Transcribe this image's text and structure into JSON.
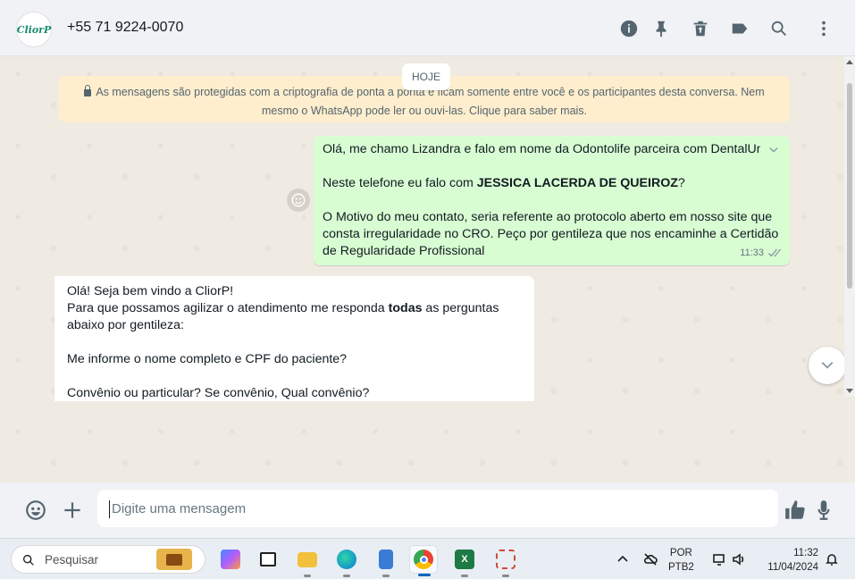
{
  "header": {
    "avatar_text": "CliorP",
    "contact_name": "+55 71 9224-0070",
    "icons": [
      "info-icon",
      "pin-icon",
      "delete-icon",
      "label-icon",
      "search-icon",
      "menu-icon"
    ]
  },
  "chat": {
    "date_chip": "HOJE",
    "encryption_notice": "As mensagens são protegidas com a criptografia de ponta a ponta e ficam somente entre você e os participantes desta conversa. Nem mesmo o WhatsApp pode ler ou ouvi-las. Clique para saber mais.",
    "outgoing": {
      "line1": "Olá, me chamo Lizandra e falo em nome da Odontolife parceira com DentalUni",
      "line2_prefix": "Neste telefone eu falo com ",
      "line2_bold": "JESSICA LACERDA DE QUEIROZ",
      "line2_suffix": "?",
      "line3": "O Motivo do meu contato, seria referente ao protocolo aberto em nosso site que consta irregularidade no CRO. Peço por gentileza que nos encaminhe a Certidão de Regularidade Profissional",
      "time": "11:33"
    },
    "incoming": {
      "line1": "Olá! Seja bem vindo a CliorP!",
      "line2_prefix": "Para que possamos agilizar o atendimento me responda ",
      "line2_bold": "todas",
      "line2_suffix": " as perguntas abaixo por gentileza:",
      "line3": "Me informe o nome completo e CPF do paciente?",
      "line4": "Convênio ou particular? Se convênio, Qual convênio?"
    }
  },
  "composer": {
    "placeholder": "Digite uma mensagem"
  },
  "taskbar": {
    "search_label": "Pesquisar",
    "lang_line1": "POR",
    "lang_line2": "PTB2",
    "time": "11:32",
    "date": "11/04/2024"
  },
  "colors": {
    "outgoing_bubble": "#d9fdd3",
    "encryption_bg": "#ffeecd",
    "chat_bg": "#efeae2"
  }
}
